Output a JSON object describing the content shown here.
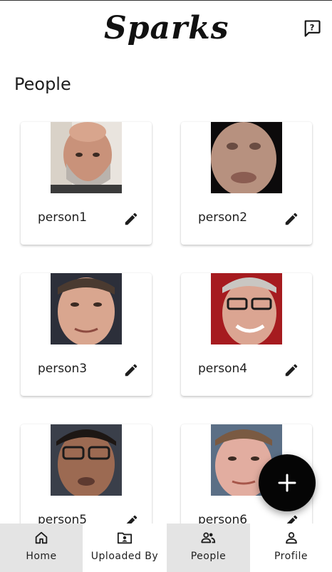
{
  "app": {
    "logo_text": "Sparks"
  },
  "header": {
    "help_icon": "help-chat-icon"
  },
  "page": {
    "title": "People"
  },
  "people": [
    {
      "name": "person1",
      "edit_icon": "pencil-icon"
    },
    {
      "name": "person2",
      "edit_icon": "pencil-icon"
    },
    {
      "name": "person3",
      "edit_icon": "pencil-icon"
    },
    {
      "name": "person4",
      "edit_icon": "pencil-icon"
    },
    {
      "name": "person5",
      "edit_icon": "pencil-icon"
    },
    {
      "name": "person6",
      "edit_icon": "pencil-icon"
    }
  ],
  "fab": {
    "icon": "plus-icon"
  },
  "bottom_nav": {
    "active": "People",
    "items": [
      {
        "label": "Home",
        "icon": "home-icon"
      },
      {
        "label": "Uploaded By",
        "icon": "folder-user-icon"
      },
      {
        "label": "People",
        "icon": "people-icon"
      },
      {
        "label": "Profile",
        "icon": "person-icon"
      }
    ]
  },
  "colors": {
    "fab_bg": "#050505",
    "nav_active_bg": "#e4e4e4",
    "text": "#1e1e1e"
  }
}
